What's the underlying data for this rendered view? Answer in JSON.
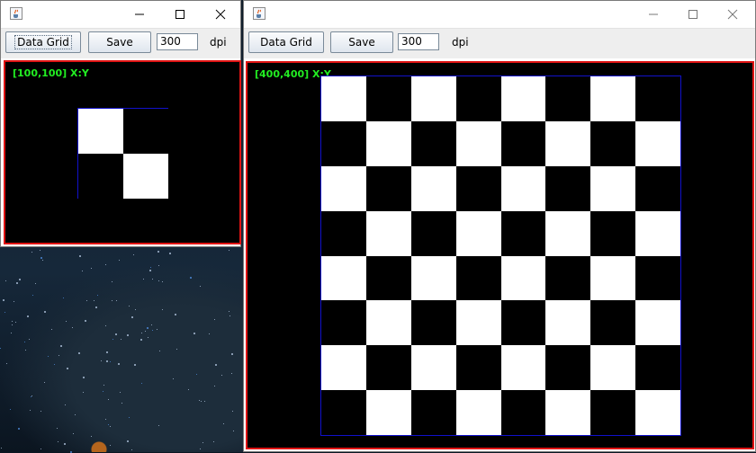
{
  "windows": [
    {
      "id": "small",
      "toolbar": {
        "data_grid_label": "Data Grid",
        "save_label": "Save",
        "dpi_value": "300",
        "dpi_unit": "dpi"
      },
      "canvas": {
        "coord_label": "[100,100] X:Y",
        "grid_size": 2
      }
    },
    {
      "id": "large",
      "toolbar": {
        "data_grid_label": "Data Grid",
        "save_label": "Save",
        "dpi_value": "300",
        "dpi_unit": "dpi"
      },
      "canvas": {
        "coord_label": "[400,400] X:Y",
        "grid_size": 8
      }
    }
  ],
  "colors": {
    "panel_border": "#e01414",
    "grid_border": "#1111cc",
    "coord_text": "#22ee22",
    "light_square": "#ffffff",
    "dark_square": "#000000"
  },
  "icons": {
    "app": "java-coffee-cup-icon",
    "minimize": "minimize-icon",
    "maximize": "maximize-icon",
    "close": "close-icon"
  }
}
